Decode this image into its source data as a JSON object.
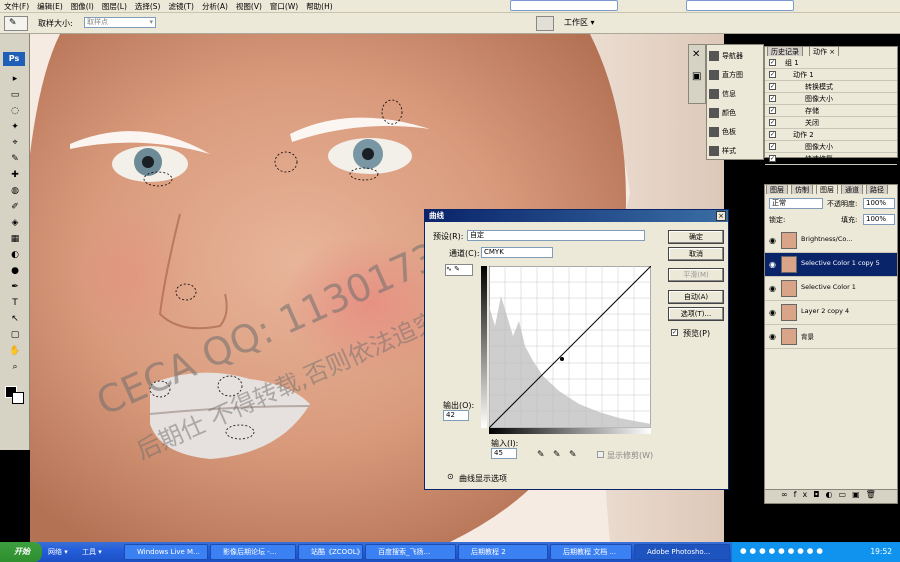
{
  "menu": [
    "文件(F)",
    "编辑(E)",
    "图像(I)",
    "图层(L)",
    "选择(S)",
    "滤镜(T)",
    "分析(A)",
    "视图(V)",
    "窗口(W)",
    "帮助(H)"
  ],
  "options_bar": {
    "sample_size_label": "取样大小:",
    "sample_size_value": "取样点",
    "workspace_label": "工作区 ▾"
  },
  "toolbox": {
    "logo": "Ps"
  },
  "watermark": {
    "line1": "CECA QQ: 113017388",
    "line2": "后期仕 不得转载,否则依法追究"
  },
  "history_panel": {
    "tabs": [
      "历史记录",
      "动作 ×"
    ],
    "rows": [
      "组 1",
      "动作 1",
      "转换模式",
      "图像大小",
      "存储",
      "关闭",
      "动作 2",
      "图像大小",
      "快速修复"
    ]
  },
  "navigator_panel": {
    "items": [
      "导航器",
      "直方图",
      "信息",
      "颜色",
      "色板",
      "样式"
    ]
  },
  "layers_panel": {
    "tabs": [
      "图层",
      "仿制",
      "图层",
      "通道",
      "路径"
    ],
    "blend_mode": "正常",
    "opacity_label": "不透明度:",
    "opacity_value": "100%",
    "lock_label": "锁定:",
    "fill_label": "填充:",
    "fill_value": "100%",
    "layers": [
      {
        "name": "Brightness/Co...",
        "selected": false
      },
      {
        "name": "Selective Color 1 copy 5",
        "selected": true
      },
      {
        "name": "Selective Color 1",
        "selected": false
      },
      {
        "name": "Layer 2 copy 4",
        "selected": false
      },
      {
        "name": "背景",
        "selected": false
      }
    ]
  },
  "curves_dialog": {
    "title": "曲线",
    "preset_label": "预设(R):",
    "preset_value": "自定",
    "channel_label": "通道(C):",
    "channel_value": "CMYK",
    "buttons": [
      "确定",
      "取消",
      "平滑(M)",
      "自动(A)",
      "选项(T)..."
    ],
    "preview_label": "预览(P)",
    "output_label": "输出(O):",
    "output_value": "42",
    "input_label": "输入(I):",
    "input_value": "45",
    "show_clipping": "显示修剪(W)",
    "display_options": "曲线显示选项"
  },
  "taskbar": {
    "start": "开始",
    "quick": [
      "网络 ▾",
      "工具 ▾"
    ],
    "tasks": [
      "Windows Live M...",
      "影像后期论坛 -...",
      "站酷《ZCOOL》...",
      "百度搜索_飞扬...",
      "后期教程 2",
      "后期教程 文档 ...",
      "Adobe Photosho..."
    ],
    "clock": "19:52"
  }
}
